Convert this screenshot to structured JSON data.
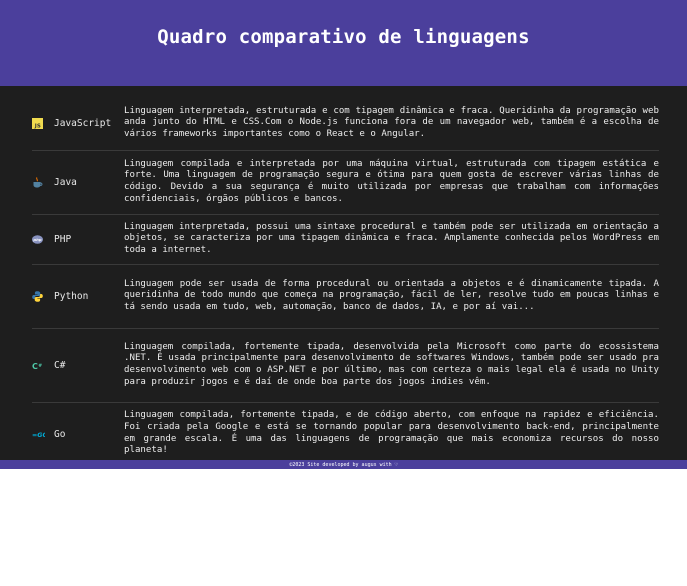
{
  "header": {
    "title": "Quadro comparativo de linguagens"
  },
  "languages": [
    {
      "name": "JavaScript",
      "icon": "javascript-icon",
      "icon_color": "#f0db4f",
      "description": "Linguagem interpretada, estruturada e com tipagem dinâmica e fraca. Queridinha da programação web anda junto do HTML e CSS.Com o Node.js funciona fora de um navegador web, também é a escolha de vários frameworks importantes como o React e o Angular."
    },
    {
      "name": "Java",
      "icon": "java-icon",
      "icon_color": "#5382a1",
      "description": "Linguagem compilada e interpretada por uma máquina virtual, estruturada com tipagem estática e forte. Uma linguagem de programação segura e ótima para quem gosta de escrever várias linhas de código. Devido a sua segurança é muito utilizada por empresas que trabalham com informações confidenciais, órgãos públicos e bancos."
    },
    {
      "name": "PHP",
      "icon": "php-icon",
      "icon_color": "#8892bf",
      "description": "Linguagem interpretada, possui uma sintaxe procedural e também pode ser utilizada em orientação a objetos, se caracteriza por uma tipagem dinâmica e fraca. Amplamente conhecida pelos WordPress em toda a internet."
    },
    {
      "name": "Python",
      "icon": "python-icon",
      "icon_color": "#3776ab",
      "description": "Linguagem pode ser usada de forma procedural ou orientada a objetos e é dinamicamente tipada. A queridinha de todo mundo que começa na programação, fácil de ler, resolve tudo em poucas linhas e tá sendo usada em tudo, web, automação, banco de dados, IA, e por aí vai..."
    },
    {
      "name": "C#",
      "icon": "csharp-icon",
      "icon_color": "#4ec9a8",
      "description": "Linguagem compilada, fortemente tipada, desenvolvida pela Microsoft como parte do ecossistema .NET. É usada principalmente para desenvolvimento de softwares Windows, também pode ser usado pra desenvolvimento web com o ASP.NET e por último, mas com certeza o mais legal ela é usada no Unity para produzir jogos e é daí de onde boa parte dos jogos indies vêm."
    },
    {
      "name": "Go",
      "icon": "go-icon",
      "icon_color": "#00add8",
      "description": "Linguagem compilada, fortemente tipada, e de código aberto, com enfoque na rapidez e eficiência. Foi criada pela Google e está se tornando popular para desenvolvimento back-end, principalmente em grande escala. É uma das linguagens de programação que mais economiza recursos do nosso planeta!"
    }
  ],
  "footer": {
    "text": "©2023 Site developed by augus with ♡"
  },
  "colors": {
    "header_bg": "#4b3f9c",
    "main_bg": "#1e1e1e"
  }
}
